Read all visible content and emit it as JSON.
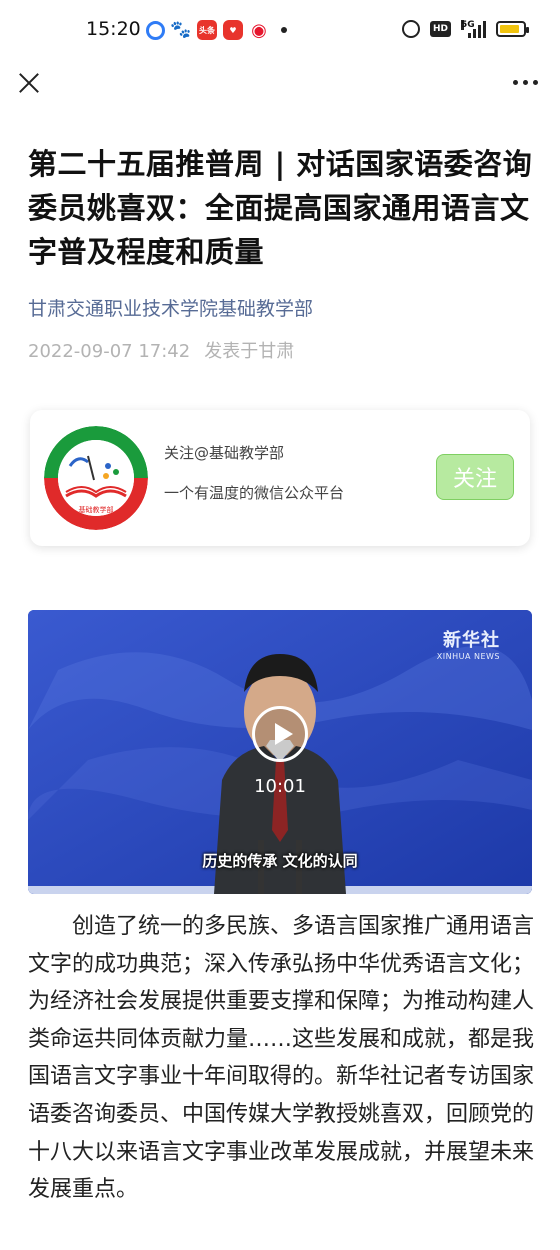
{
  "status_bar": {
    "time": "15:20",
    "notification_icons": [
      "qq-browser-icon",
      "baidu-paw-icon",
      "toutiao-icon",
      "pinduoduo-icon",
      "weibo-icon"
    ],
    "toutiao_label": "头条",
    "hd_label": "HD",
    "network_label": "5G",
    "battery_level": 0.85,
    "battery_color": "#f1c40f"
  },
  "nav": {
    "close_icon": "close-icon",
    "more_icon": "more-icon"
  },
  "article": {
    "title": "第二十五届推普周 | 对话国家语委咨询委员姚喜双：全面提高国家通用语言文字普及程度和质量",
    "account": "甘肃交通职业技术学院基础教学部",
    "date": "2022-09-07 17:42",
    "location": "发表于甘肃",
    "link_color": "#576b95"
  },
  "profile_card": {
    "name": "关注@基础教学部",
    "description": "一个有温度的微信公众平台",
    "follow_label": "关注",
    "logo_bottom_text": "基础教学部"
  },
  "video": {
    "watermark": "新华社",
    "watermark_sub": "XINHUA NEWS",
    "duration": "10:01",
    "subtitle": "历史的传承  文化的认同"
  },
  "body": {
    "paragraph": "创造了统一的多民族、多语言国家推广通用语言文字的成功典范；深入传承弘扬中华优秀语言文化；为经济社会发展提供重要支撑和保障；为推动构建人类命运共同体贡献力量……这些发展和成就，都是我国语言文字事业十年间取得的。新华社记者专访国家语委咨询委员、中国传媒大学教授姚喜双，回顾党的十八大以来语言文字事业改革发展成就，并展望未来发展重点。"
  }
}
